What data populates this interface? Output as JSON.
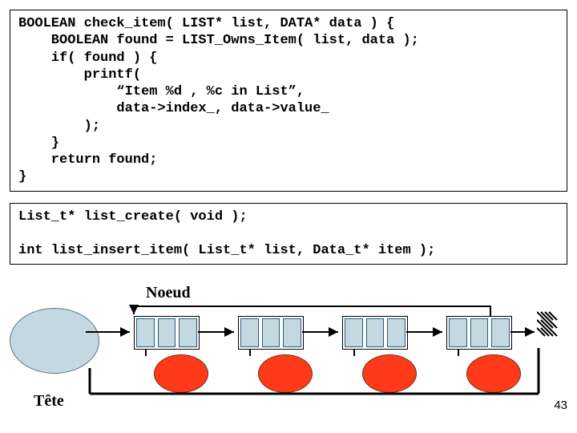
{
  "code1": "BOOLEAN check_item( LIST* list, DATA* data ) {\n    BOOLEAN found = LIST_Owns_Item( list, data );\n    if( found ) {\n        printf(\n            “Item %d , %c in List”,\n            data->index_, data->value_\n        );\n    }\n    return found;\n}",
  "code2": "List_t* list_create( void );\n\nint list_insert_item( List_t* list, Data_t* item );",
  "labels": {
    "noeud": "Noeud",
    "tete": "Tête"
  },
  "pageNumber": "43"
}
